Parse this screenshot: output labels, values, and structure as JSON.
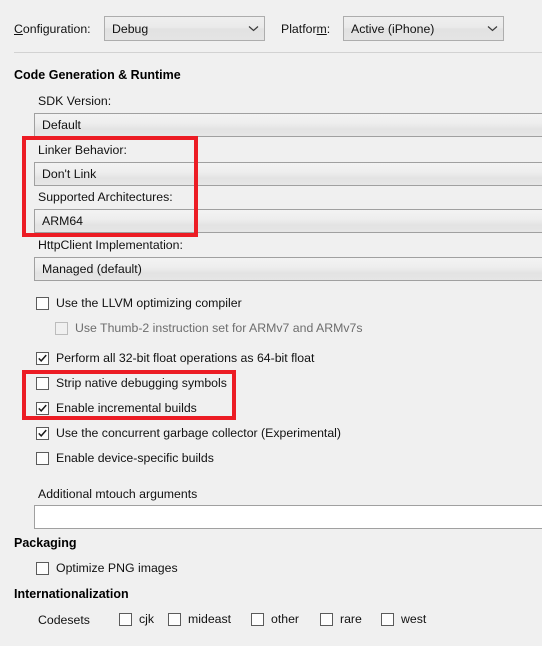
{
  "toolbar": {
    "configuration_label": "Configuration:",
    "configuration_accel": "C",
    "configuration_label_rest": "onfiguration:",
    "configuration_value": "Debug",
    "platform_label_pre": "Platfor",
    "platform_accel": "m",
    "platform_label_post": ":",
    "platform_value": "Active (iPhone)"
  },
  "sections": {
    "code_generation": {
      "title": "Code Generation & Runtime",
      "fields": [
        {
          "label": "SDK Version:",
          "value": "Default"
        },
        {
          "label": "Linker Behavior:",
          "value": "Don't Link"
        },
        {
          "label": "Supported Architectures:",
          "value": "ARM64"
        },
        {
          "label": "HttpClient Implementation:",
          "value": "Managed (default)"
        }
      ],
      "checkboxes": [
        {
          "label": "Use the LLVM optimizing compiler",
          "checked": false,
          "disabled": false
        },
        {
          "label": "Use Thumb-2 instruction set for ARMv7 and ARMv7s",
          "checked": false,
          "disabled": true
        },
        {
          "label": "Perform all 32-bit float operations as 64-bit float",
          "checked": true,
          "disabled": false
        },
        {
          "label": "Strip native debugging symbols",
          "checked": false,
          "disabled": false
        },
        {
          "label": "Enable incremental builds",
          "checked": true,
          "disabled": false
        },
        {
          "label": "Use the concurrent garbage collector (Experimental)",
          "checked": true,
          "disabled": false
        },
        {
          "label": "Enable device-specific builds",
          "checked": false,
          "disabled": false
        }
      ],
      "mtouch": {
        "label": "Additional mtouch arguments",
        "value": "",
        "placeholder": ""
      }
    },
    "packaging": {
      "title": "Packaging",
      "checkboxes": [
        {
          "label": "Optimize PNG images",
          "checked": false,
          "disabled": false
        }
      ]
    },
    "internationalization": {
      "title": "Internationalization",
      "codesets_label": "Codesets",
      "codesets": [
        {
          "label": "cjk",
          "checked": false
        },
        {
          "label": "mideast",
          "checked": false
        },
        {
          "label": "other",
          "checked": false
        },
        {
          "label": "rare",
          "checked": false
        },
        {
          "label": "west",
          "checked": false
        }
      ]
    }
  },
  "annotations": {
    "highlight_color": "#ec1c24",
    "boxes": [
      {
        "name": "linker-architectures-highlight"
      },
      {
        "name": "strip-incremental-highlight"
      }
    ]
  }
}
